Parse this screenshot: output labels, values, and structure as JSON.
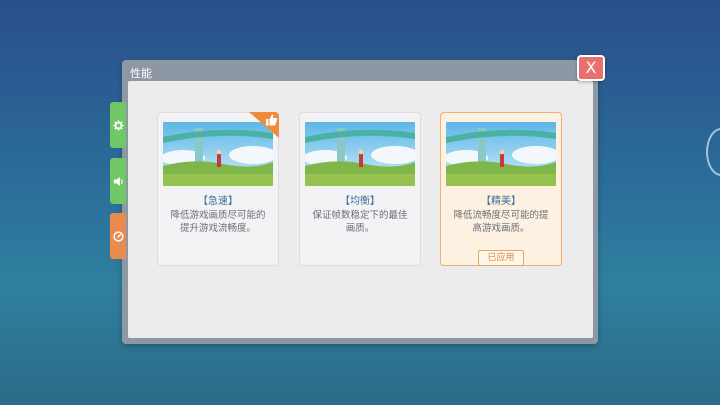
{
  "dialog": {
    "title": "性能"
  },
  "close": {
    "label": "X"
  },
  "tabs": [
    {
      "icon": "gear-icon"
    },
    {
      "icon": "speaker-icon"
    },
    {
      "icon": "gauge-icon"
    }
  ],
  "cards": [
    {
      "title": "【急速】",
      "desc": "降低游戏画质尽可能的提升游戏流畅度。",
      "recommended": true
    },
    {
      "title": "【均衡】",
      "desc": "保证帧数稳定下的最佳画质。"
    },
    {
      "title": "【精美】",
      "desc": "降低流畅度尽可能的提高游戏画质。",
      "applied_label": "已应用"
    }
  ],
  "colors": {
    "accent_orange": "#e98a4e",
    "tab_green": "#6fc766",
    "title_blue": "#3c6f9e",
    "close_red": "#e8706e"
  }
}
